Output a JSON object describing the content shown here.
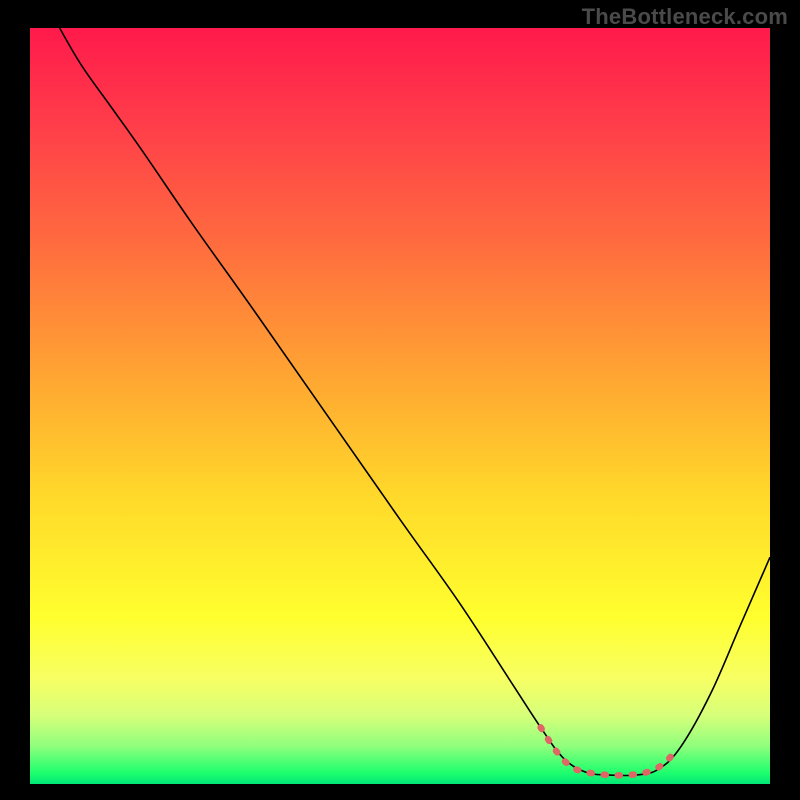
{
  "watermark": "TheBottleneck.com",
  "chart_data": {
    "type": "line",
    "title": "",
    "xlabel": "",
    "ylabel": "",
    "xlim": [
      0,
      100
    ],
    "ylim": [
      0,
      100
    ],
    "grid": false,
    "background_gradient": {
      "stops": [
        {
          "offset": 0.0,
          "color": "#ff1a4b"
        },
        {
          "offset": 0.12,
          "color": "#ff3b4a"
        },
        {
          "offset": 0.28,
          "color": "#ff6a3f"
        },
        {
          "offset": 0.46,
          "color": "#ffa532"
        },
        {
          "offset": 0.62,
          "color": "#ffd92a"
        },
        {
          "offset": 0.78,
          "color": "#ffff2e"
        },
        {
          "offset": 0.86,
          "color": "#f7ff63"
        },
        {
          "offset": 0.91,
          "color": "#d6ff7a"
        },
        {
          "offset": 0.95,
          "color": "#8fff7d"
        },
        {
          "offset": 0.985,
          "color": "#1eff6e"
        },
        {
          "offset": 1.0,
          "color": "#00e676"
        }
      ]
    },
    "series": [
      {
        "name": "bottleneck-curve",
        "stroke": "#000000",
        "stroke_width": 1.6,
        "points": [
          {
            "x": 4.0,
            "y": 100.0
          },
          {
            "x": 7.0,
            "y": 95.0
          },
          {
            "x": 11.0,
            "y": 89.5
          },
          {
            "x": 15.0,
            "y": 84.0
          },
          {
            "x": 22.0,
            "y": 74.0
          },
          {
            "x": 30.0,
            "y": 63.0
          },
          {
            "x": 40.0,
            "y": 49.0
          },
          {
            "x": 50.0,
            "y": 35.0
          },
          {
            "x": 58.0,
            "y": 24.0
          },
          {
            "x": 65.0,
            "y": 13.5
          },
          {
            "x": 69.0,
            "y": 7.5
          },
          {
            "x": 72.0,
            "y": 3.5
          },
          {
            "x": 75.0,
            "y": 1.6
          },
          {
            "x": 78.0,
            "y": 1.2
          },
          {
            "x": 82.0,
            "y": 1.2
          },
          {
            "x": 85.0,
            "y": 2.0
          },
          {
            "x": 88.0,
            "y": 5.0
          },
          {
            "x": 92.0,
            "y": 12.0
          },
          {
            "x": 96.0,
            "y": 21.0
          },
          {
            "x": 100.0,
            "y": 30.0
          }
        ]
      },
      {
        "name": "optimal-region-marker",
        "stroke": "#e06666",
        "stroke_width": 6.5,
        "linecap": "round",
        "points": [
          {
            "x": 69.0,
            "y": 7.5
          },
          {
            "x": 71.0,
            "y": 4.5
          },
          {
            "x": 73.0,
            "y": 2.4
          },
          {
            "x": 75.0,
            "y": 1.6
          },
          {
            "x": 78.0,
            "y": 1.2
          },
          {
            "x": 81.0,
            "y": 1.2
          },
          {
            "x": 83.5,
            "y": 1.6
          },
          {
            "x": 85.5,
            "y": 2.6
          },
          {
            "x": 87.5,
            "y": 4.6
          }
        ]
      }
    ]
  }
}
